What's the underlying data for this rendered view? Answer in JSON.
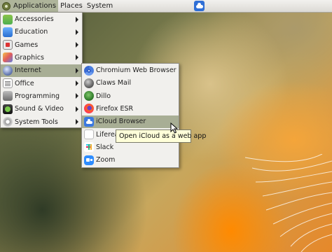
{
  "panel": {
    "applications_label": "Applications",
    "places_label": "Places",
    "system_label": "System",
    "launcher_icon": "icloud-icon"
  },
  "applications_menu": {
    "items": [
      {
        "label": "Accessories",
        "icon": "accessories-icon",
        "submenu": true
      },
      {
        "label": "Education",
        "icon": "education-icon",
        "submenu": true
      },
      {
        "label": "Games",
        "icon": "games-icon",
        "submenu": true
      },
      {
        "label": "Graphics",
        "icon": "graphics-icon",
        "submenu": true
      },
      {
        "label": "Internet",
        "icon": "internet-icon",
        "submenu": true,
        "highlighted": true
      },
      {
        "label": "Office",
        "icon": "office-icon",
        "submenu": true
      },
      {
        "label": "Programming",
        "icon": "programming-icon",
        "submenu": true
      },
      {
        "label": "Sound & Video",
        "icon": "sound-video-icon",
        "submenu": true
      },
      {
        "label": "System Tools",
        "icon": "system-tools-icon",
        "submenu": true
      }
    ]
  },
  "internet_submenu": {
    "items": [
      {
        "label": "Chromium Web Browser",
        "icon": "chromium-icon"
      },
      {
        "label": "Claws Mail",
        "icon": "claws-mail-icon"
      },
      {
        "label": "Dillo",
        "icon": "dillo-icon"
      },
      {
        "label": "Firefox ESR",
        "icon": "firefox-icon"
      },
      {
        "label": "iCloud Browser",
        "icon": "icloud-icon",
        "highlighted": true
      },
      {
        "label": "Liferea",
        "icon": "liferea-icon"
      },
      {
        "label": "Slack",
        "icon": "slack-icon"
      },
      {
        "label": "Zoom",
        "icon": "zoom-icon"
      }
    ]
  },
  "tooltip": {
    "text": "Open iCloud as a web app"
  },
  "colors": {
    "highlight": "#a8ae95",
    "menu_bg": "#f1f0ed",
    "tooltip_bg": "#ffffd9"
  }
}
